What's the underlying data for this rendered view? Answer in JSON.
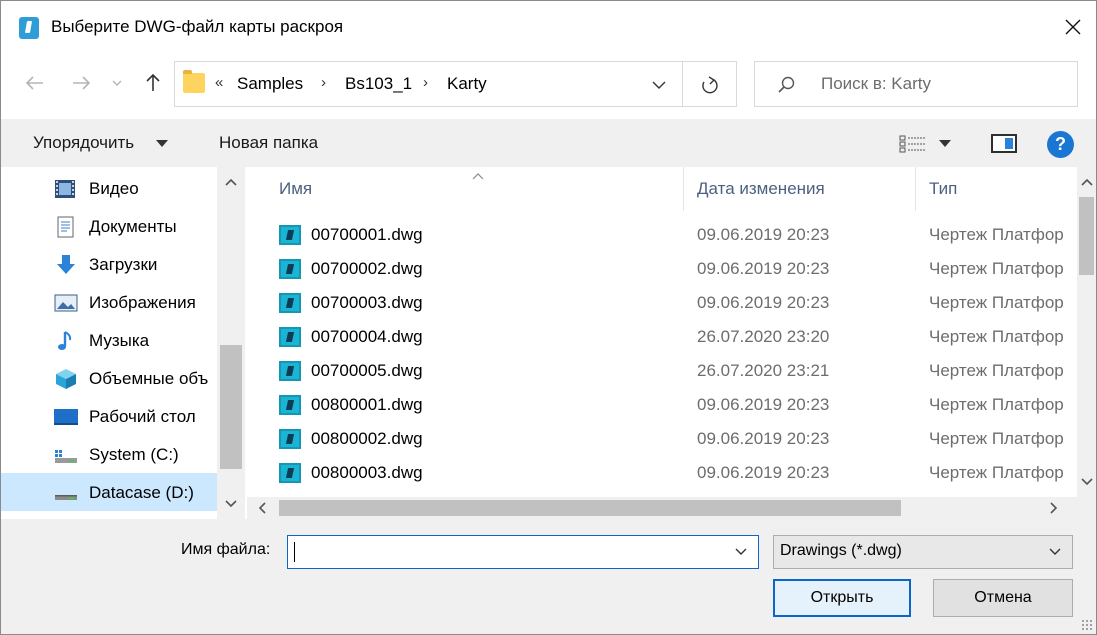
{
  "window": {
    "title": "Выберите DWG-файл карты раскроя"
  },
  "address": {
    "overflow": "«",
    "crumbs": [
      "Samples",
      "Bs103_1",
      "Karty"
    ]
  },
  "search": {
    "placeholder": "Поиск в: Karty"
  },
  "toolbar": {
    "organize_label": "Упорядочить",
    "new_folder_label": "Новая папка",
    "help_label": "?"
  },
  "nav": {
    "items": [
      {
        "label": "Видео",
        "icon": "video-icon"
      },
      {
        "label": "Документы",
        "icon": "documents-icon"
      },
      {
        "label": "Загрузки",
        "icon": "downloads-icon"
      },
      {
        "label": "Изображения",
        "icon": "pictures-icon"
      },
      {
        "label": "Музыка",
        "icon": "music-icon"
      },
      {
        "label": "Объемные объ",
        "icon": "3d-objects-icon"
      },
      {
        "label": "Рабочий стол",
        "icon": "desktop-icon"
      },
      {
        "label": "System (C:)",
        "icon": "system-drive-icon"
      },
      {
        "label": "Datacase (D:)",
        "icon": "drive-icon",
        "selected": true
      }
    ]
  },
  "list": {
    "columns": {
      "name": "Имя",
      "date": "Дата изменения",
      "type": "Тип"
    },
    "files": [
      {
        "name": "00700001.dwg",
        "date": "09.06.2019 20:23",
        "type": "Чертеж Платфор"
      },
      {
        "name": "00700002.dwg",
        "date": "09.06.2019 20:23",
        "type": "Чертеж Платфор"
      },
      {
        "name": "00700003.dwg",
        "date": "09.06.2019 20:23",
        "type": "Чертеж Платфор"
      },
      {
        "name": "00700004.dwg",
        "date": "26.07.2020 23:20",
        "type": "Чертеж Платфор"
      },
      {
        "name": "00700005.dwg",
        "date": "26.07.2020 23:21",
        "type": "Чертеж Платфор"
      },
      {
        "name": "00800001.dwg",
        "date": "09.06.2019 20:23",
        "type": "Чертеж Платфор"
      },
      {
        "name": "00800002.dwg",
        "date": "09.06.2019 20:23",
        "type": "Чертеж Платфор"
      },
      {
        "name": "00800003.dwg",
        "date": "09.06.2019 20:23",
        "type": "Чертеж Платфор"
      }
    ]
  },
  "bottom": {
    "filename_label": "Имя файла:",
    "filename_value": "",
    "filetype_value": "Drawings (*.dwg)",
    "open_label": "Открыть",
    "cancel_label": "Отмена"
  }
}
